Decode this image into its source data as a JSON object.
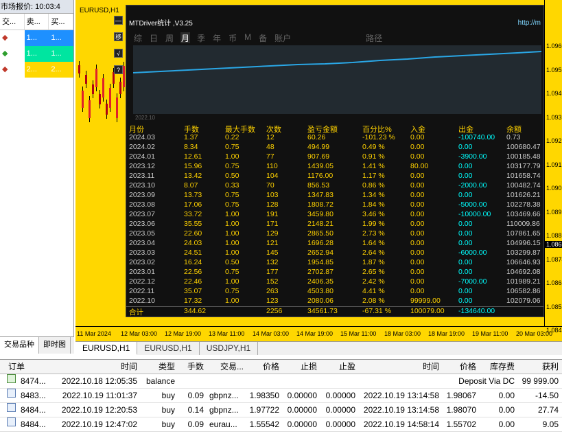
{
  "market_watch": {
    "title": "市场报价: 10:03:4",
    "headers": [
      "交...",
      "卖...",
      "买..."
    ],
    "rows": [
      {
        "c1": "1...",
        "c2": "1...",
        "bg": "#1e90ff"
      },
      {
        "c1": "1...",
        "c2": "1...",
        "bg": "#00e5a0"
      },
      {
        "c1": "2...",
        "c2": "2...",
        "bg": "#ffd700"
      }
    ],
    "tabs": [
      "交易品种",
      "即时图"
    ]
  },
  "chart": {
    "title": "EURUSD,H1",
    "price_labels": [
      "1.0960",
      "1.0950",
      "1.0940",
      "1.0931",
      "1.0921",
      "1.0912",
      "1.0902",
      "1.0893",
      "1.0883",
      "1.0874",
      "1.0864",
      "1.0855",
      "1.0845",
      "1.0836"
    ],
    "current_price": "1.0869",
    "time_labels": [
      "11 Mar 2024",
      "12 Mar 03:00",
      "12 Mar 19:00",
      "13 Mar 11:00",
      "14 Mar 03:00",
      "14 Mar 19:00",
      "15 Mar 11:00",
      "18 Mar 03:00",
      "18 Mar 19:00",
      "19 Mar 11:00",
      "20 Mar 03:00"
    ]
  },
  "panel": {
    "title": "MTDriver统计 ,V3.25",
    "url": "http://m",
    "side_buttons": [
      "—",
      "移",
      "√",
      "?"
    ],
    "tabs": [
      "综",
      "日",
      "周",
      "月",
      "季",
      "年",
      "币",
      "M",
      "备",
      "账户",
      "路径"
    ],
    "active_tab": "月",
    "equity_date": "2022.10",
    "columns": [
      "月份",
      "手数",
      "最大手数",
      "次数",
      "盈亏金额",
      "百分比%",
      "入金",
      "出金",
      "余额"
    ],
    "rows": [
      [
        "2024.03",
        "1.37",
        "0.22",
        "12",
        "60.26",
        "-101.23 %",
        "0.00",
        "-100740.00",
        "0.73"
      ],
      [
        "2024.02",
        "8.34",
        "0.75",
        "48",
        "494.99",
        "0.49 %",
        "0.00",
        "0.00",
        "100680.47"
      ],
      [
        "2024.01",
        "12.61",
        "1.00",
        "77",
        "907.69",
        "0.91 %",
        "0.00",
        "-3900.00",
        "100185.48"
      ],
      [
        "2023.12",
        "15.96",
        "0.75",
        "110",
        "1439.05",
        "1.41 %",
        "80.00",
        "0.00",
        "103177.79"
      ],
      [
        "2023.11",
        "13.42",
        "0.50",
        "104",
        "1176.00",
        "1.17 %",
        "0.00",
        "0.00",
        "101658.74"
      ],
      [
        "2023.10",
        "8.07",
        "0.33",
        "70",
        "856.53",
        "0.86 %",
        "0.00",
        "-2000.00",
        "100482.74"
      ],
      [
        "2023.09",
        "13.73",
        "0.75",
        "103",
        "1347.83",
        "1.34 %",
        "0.00",
        "0.00",
        "101626.21"
      ],
      [
        "2023.08",
        "17.06",
        "0.75",
        "128",
        "1808.72",
        "1.84 %",
        "0.00",
        "-5000.00",
        "102278.38"
      ],
      [
        "2023.07",
        "33.72",
        "1.00",
        "191",
        "3459.80",
        "3.46 %",
        "0.00",
        "-10000.00",
        "103469.66"
      ],
      [
        "2023.06",
        "35.55",
        "1.00",
        "171",
        "2148.21",
        "1.99 %",
        "0.00",
        "0.00",
        "110009.86"
      ],
      [
        "2023.05",
        "22.60",
        "1.00",
        "129",
        "2865.50",
        "2.73 %",
        "0.00",
        "0.00",
        "107861.65"
      ],
      [
        "2023.04",
        "24.03",
        "1.00",
        "121",
        "1696.28",
        "1.64 %",
        "0.00",
        "0.00",
        "104996.15"
      ],
      [
        "2023.03",
        "24.51",
        "1.00",
        "145",
        "2652.94",
        "2.64 %",
        "0.00",
        "-6000.00",
        "103299.87"
      ],
      [
        "2023.02",
        "16.24",
        "0.50",
        "132",
        "1954.85",
        "1.87 %",
        "0.00",
        "0.00",
        "106646.93"
      ],
      [
        "2023.01",
        "22.56",
        "0.75",
        "177",
        "2702.87",
        "2.65 %",
        "0.00",
        "0.00",
        "104692.08"
      ],
      [
        "2022.12",
        "22.46",
        "1.00",
        "152",
        "2406.35",
        "2.42 %",
        "0.00",
        "-7000.00",
        "101989.21"
      ],
      [
        "2022.11",
        "35.07",
        "0.75",
        "263",
        "4503.80",
        "4.41 %",
        "0.00",
        "0.00",
        "106582.86"
      ],
      [
        "2022.10",
        "17.32",
        "1.00",
        "123",
        "2080.06",
        "2.08 %",
        "99999.00",
        "0.00",
        "102079.06"
      ]
    ],
    "total": [
      "合计",
      "344.62",
      "",
      "2256",
      "34561.73",
      "-67.31 %",
      "100079.00",
      "-134640.00",
      ""
    ]
  },
  "chart_tabs": [
    "EURUSD,H1",
    "EURUSD,H1",
    "USDJPY,H1"
  ],
  "terminal": {
    "headers": [
      "订单",
      "时间",
      "类型",
      "手数",
      "交易...",
      "价格",
      "止损",
      "止盈",
      "时间",
      "价格",
      "库存费",
      "获利"
    ],
    "rows": [
      {
        "icon": "balance",
        "order": "8474...",
        "time": "2022.10.18 12:05:35",
        "type": "balance",
        "comment": "Deposit Via DC",
        "profit": "99 999.00"
      },
      {
        "icon": "trade",
        "order": "8483...",
        "time": "2022.10.19 11:01:37",
        "type": "buy",
        "lots": "0.09",
        "symbol": "gbpnz...",
        "price": "1.98350",
        "sl": "0.00000",
        "tp": "0.00000",
        "ctime": "2022.10.19 13:14:58",
        "cprice": "1.98067",
        "swap": "0.00",
        "profit": "-14.50"
      },
      {
        "icon": "trade",
        "order": "8484...",
        "time": "2022.10.19 12:20:53",
        "type": "buy",
        "lots": "0.14",
        "symbol": "gbpnz...",
        "price": "1.97722",
        "sl": "0.00000",
        "tp": "0.00000",
        "ctime": "2022.10.19 13:14:58",
        "cprice": "1.98070",
        "swap": "0.00",
        "profit": "27.74"
      },
      {
        "icon": "trade",
        "order": "8484...",
        "time": "2022.10.19 12:47:02",
        "type": "buy",
        "lots": "0.09",
        "symbol": "eurau...",
        "price": "1.55542",
        "sl": "0.00000",
        "tp": "0.00000",
        "ctime": "2022.10.19 14:58:14",
        "cprice": "1.55702",
        "swap": "0.00",
        "profit": "9.05"
      }
    ]
  }
}
